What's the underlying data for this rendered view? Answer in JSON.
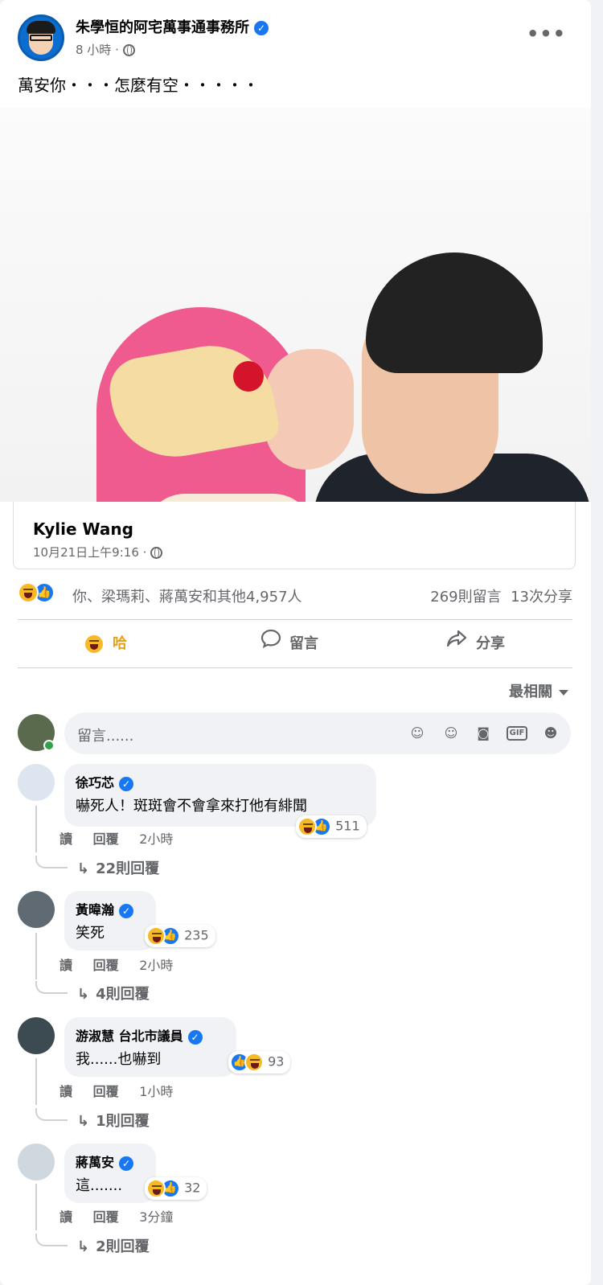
{
  "post": {
    "page_name": "朱學恒的阿宅萬事通事務所",
    "meta": "8 小時 ·",
    "text": "萬安你・・・怎麼有空・・・・・"
  },
  "shared_source": {
    "name": "Kylie Wang",
    "time": "10月21日上午9:16 ·"
  },
  "reactions": {
    "reactors_text": "你、梁瑪莉、蔣萬安和其他4,957人",
    "comments_count": "269則留言",
    "shares_count": "13次分享"
  },
  "actions": {
    "react_label": "哈",
    "comment_label": "留言",
    "share_label": "分享"
  },
  "sort_label": "最相關",
  "composer": {
    "placeholder": "留言......"
  },
  "comment_actions": {
    "like": "讀",
    "reply": "回覆"
  },
  "comments": [
    {
      "name": "徐巧芯",
      "text": "嚇死人！斑斑會不會拿來打他有緋聞",
      "reaction_count": "511",
      "time": "2小時",
      "replies": "22則回覆"
    },
    {
      "name": "黃暐瀚",
      "text": "笑死",
      "reaction_count": "235",
      "time": "2小時",
      "replies": "4則回覆"
    },
    {
      "name": "游淑慧 台北市議員",
      "text": "我......也嚇到",
      "reaction_count": "93",
      "time": "1小時",
      "replies": "1則回覆"
    },
    {
      "name": "蔣萬安",
      "text": "這.......",
      "reaction_count": "32",
      "time": "3分鐘",
      "replies": "2則回覆"
    }
  ],
  "colors": {
    "accent": "#1877f2",
    "haha": "#f7b928",
    "secondary_text": "#65676b",
    "bubble": "#f0f2f5"
  }
}
